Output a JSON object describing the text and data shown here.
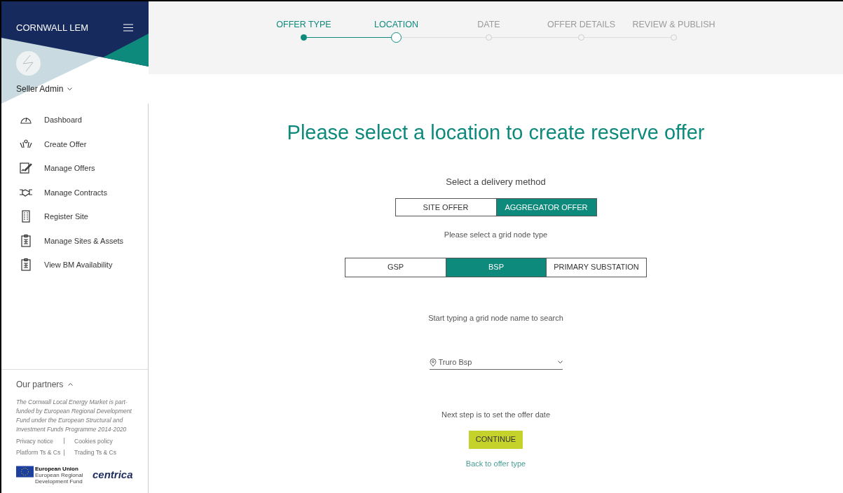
{
  "sidebar": {
    "brand": "CORNWALL LEM",
    "user": "Seller Admin",
    "items": [
      {
        "label": "Dashboard"
      },
      {
        "label": "Create Offer"
      },
      {
        "label": "Manage Offers"
      },
      {
        "label": "Manage Contracts"
      },
      {
        "label": "Register Site"
      },
      {
        "label": "Manage Sites & Assets"
      },
      {
        "label": "View BM Availability"
      }
    ],
    "partners": {
      "title": "Our partners",
      "expanded": true,
      "text": "The Cornwall Local Energy Market is part-funded by European Regional Development Fund under the European Structural and Investment Funds Programme 2014-2020",
      "links": [
        [
          "Privacy notice",
          "Cookies policy"
        ],
        [
          "Platform Ts & Cs",
          "Trading Ts & Cs"
        ]
      ],
      "eu_logo": {
        "title": "European Union",
        "subtitle": "European Regional Development Fund"
      },
      "partner_logo": "centrica"
    }
  },
  "stepper": [
    {
      "label": "OFFER TYPE",
      "completed": true,
      "selected": false
    },
    {
      "label": "LOCATION",
      "completed": false,
      "selected": true
    },
    {
      "label": "DATE",
      "completed": false,
      "selected": false
    },
    {
      "label": "OFFER DETAILS",
      "completed": false,
      "selected": false
    },
    {
      "label": "REVIEW & PUBLISH",
      "completed": false,
      "selected": false
    }
  ],
  "heading": "Please select a location to create reserve offer",
  "delivery": {
    "label": "Select a delivery method",
    "options": [
      {
        "label": "SITE OFFER",
        "selected": false
      },
      {
        "label": "AGGREGATOR OFFER",
        "selected": true
      }
    ]
  },
  "node_type": {
    "label": "Please select a grid node type",
    "options": [
      {
        "label": "GSP",
        "selected": false
      },
      {
        "label": "BSP",
        "selected": true
      },
      {
        "label": "PRIMARY SUBSTATION",
        "selected": false
      }
    ]
  },
  "search": {
    "label": "Start typing a grid node name to search",
    "value": "Truro Bsp"
  },
  "next_step": "Next step is to set the offer date",
  "continue_button": "CONTINUE",
  "back_link": "Back to offer type"
}
